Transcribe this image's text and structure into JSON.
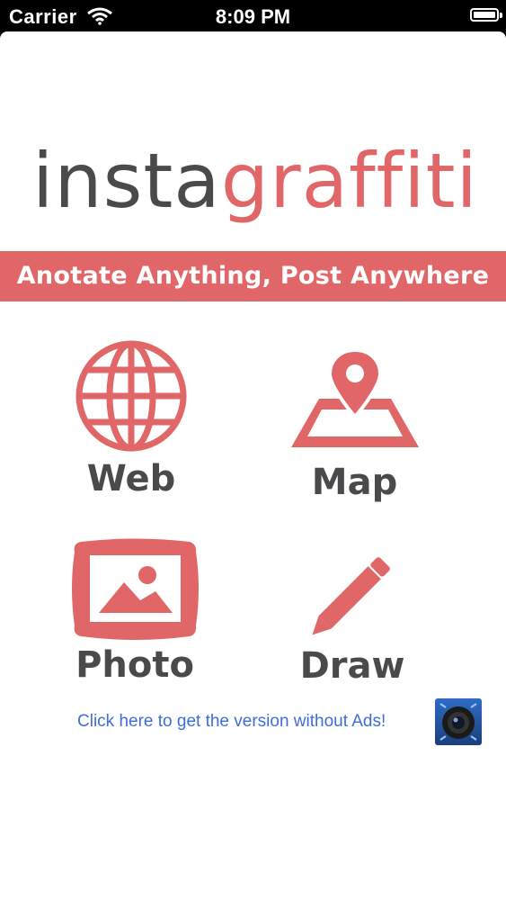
{
  "status_bar": {
    "carrier": "Carrier",
    "time": "8:09 PM"
  },
  "logo": {
    "part1": "insta",
    "part2": "graffiti"
  },
  "tagline": "Anotate Anything, Post Anywhere",
  "menu": {
    "web": "Web",
    "map": "Map",
    "photo": "Photo",
    "draw": "Draw"
  },
  "promo": {
    "text": "Click here to get the version without Ads!"
  },
  "colors": {
    "accent": "#e06668",
    "dark": "#4a4a4d",
    "link": "#3d6ed8"
  }
}
